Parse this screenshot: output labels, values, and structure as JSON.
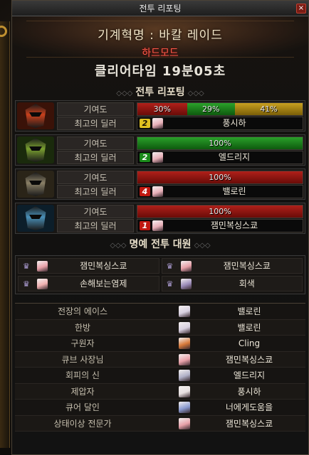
{
  "window": {
    "title": "전투 리포팅"
  },
  "header": {
    "dungeon_name": "기계혁명 : 바칼 레이드",
    "difficulty": "하드모드"
  },
  "clear_time": "클리어타임  19분05초",
  "battle_report": {
    "section_title": "전투 리포팅",
    "contribution_label": "기여도",
    "top_dealer_label": "최고의 딜러",
    "parties": [
      {
        "helm_color": "#c8401c",
        "helm_bg": "#3a1208",
        "segments": [
          {
            "color": "red",
            "fraction": 0.3,
            "label": "30%"
          },
          {
            "color": "green",
            "fraction": 0.29,
            "label": "29%"
          },
          {
            "color": "gold",
            "fraction": 0.41,
            "label": "41%"
          }
        ],
        "dealer_rank": "2",
        "dealer_rank_color": "gold",
        "dealer_name": "풍시하"
      },
      {
        "helm_color": "#7aa030",
        "helm_bg": "#1a2a0c",
        "segments": [
          {
            "color": "green",
            "fraction": 1.0,
            "label": "100%"
          }
        ],
        "dealer_rank": "2",
        "dealer_rank_color": "green",
        "dealer_name": "엘드리지"
      },
      {
        "helm_color": "#8a8066",
        "helm_bg": "#2a2418",
        "segments": [
          {
            "color": "red",
            "fraction": 1.0,
            "label": "100%"
          }
        ],
        "dealer_rank": "4",
        "dealer_rank_color": "red",
        "dealer_name": "밸로린"
      },
      {
        "helm_color": "#4a90b8",
        "helm_bg": "#0c1e2a",
        "segments": [
          {
            "color": "red",
            "fraction": 1.0,
            "label": "100%"
          }
        ],
        "dealer_rank": "1",
        "dealer_rank_color": "red",
        "dealer_name": "잼민복싱스쿄"
      }
    ]
  },
  "mvp": {
    "section_title": "명예 전투 대원",
    "members": [
      {
        "name": "잼민복싱스쿄",
        "face": "#e8a0a8"
      },
      {
        "name": "잼민복싱스쿄",
        "face": "#e8a0a8"
      },
      {
        "name": "손해보는염제",
        "face": "#f0b0b0"
      },
      {
        "name": "회색",
        "face": "#9a8ab8"
      }
    ]
  },
  "awards": [
    {
      "title": "전장의 에이스",
      "name": "밸로린",
      "face": "#d8d0e0"
    },
    {
      "title": "한방",
      "name": "밸로린",
      "face": "#d8d0e0"
    },
    {
      "title": "구원자",
      "name": "Cling",
      "face": "#d87a3a"
    },
    {
      "title": "큐브 사장님",
      "name": "잼민복싱스쿄",
      "face": "#e8a0a8"
    },
    {
      "title": "회피의 신",
      "name": "엘드리지",
      "face": "#b0b0c8"
    },
    {
      "title": "제압자",
      "name": "풍시하",
      "face": "#e8e0e0"
    },
    {
      "title": "큐어 달인",
      "name": "너에게도움을",
      "face": "#8a9ad0"
    },
    {
      "title": "상태이상 전문가",
      "name": "잼민복싱스쿄",
      "face": "#e8a0a8"
    }
  ],
  "colors": {
    "red": "#b0201a",
    "green": "#2aa02a",
    "gold": "#c8a020",
    "rank_gold_bg": "#e0c020",
    "rank_green_bg": "#1a8a1a",
    "rank_red_bg": "#c01810"
  }
}
